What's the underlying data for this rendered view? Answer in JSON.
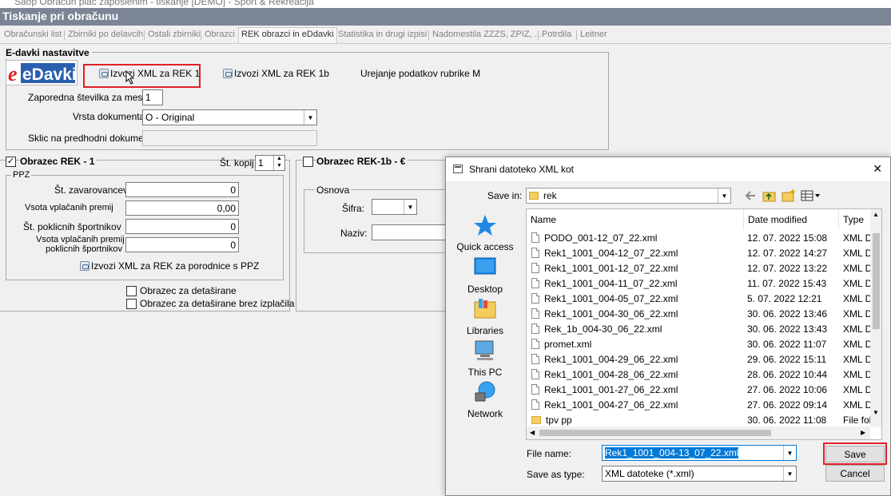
{
  "window": {
    "title": "Saop Obračun plač zaposlenim - tiskanje [DEMO] - Šport & Rekreacija",
    "header": "Tiskanje pri obračunu"
  },
  "tabs": [
    "Obračunski list",
    "Zbirniki po delavcih",
    "Ostali zbirniki",
    "Obrazci",
    "REK obrazci  in eDdavki",
    "Statistika in drugi izpisi",
    "Nadomestila ZZZS, ZPIZ, ...",
    "Potrdila",
    "Leitner"
  ],
  "edavki": {
    "group_title": "E-davki nastavitve",
    "logo_text": "eDavki",
    "btn_rek1": "Izvozi XML za REK 1",
    "btn_rek1b": "Izvozi XML za REK 1b",
    "btn_rubrika_m": "Urejanje podatkov rubrike M",
    "zaporedna_label": "Zaporedna številka za mesec",
    "zaporedna_value": "1",
    "vrsta_label": "Vrsta dokumenta",
    "vrsta_value": "O - Original",
    "sklic_label": "Sklic na predhodni dokument",
    "sklic_value": ""
  },
  "rek1": {
    "title": "Obrazec REK - 1",
    "checked": true,
    "kopij_label": "Št. kopij",
    "kopij_value": "1",
    "ppz_title": "PPZ",
    "zavarovancev_label": "Št. zavarovancev",
    "zavarovancev_value": "0",
    "vplacanih_label": "Vsota vplačanih premij",
    "vplacanih_value": "0,00",
    "sportnikov_label": "Št. poklicnih športnikov",
    "sportnikov_value": "0",
    "vsota_sport_label1": "Vsota vplačanih premij",
    "vsota_sport_label2": "poklicnih športnikov",
    "vsota_sport_value": "0",
    "btn_ppz": "Izvozi XML za REK za porodnice s PPZ",
    "chk_detasirane": "Obrazec za detaširane",
    "chk_detasirane_brez": "Obrazec za detaširane brez izplačila"
  },
  "rek1b": {
    "title": "Obrazec REK-1b - €",
    "checked": false,
    "osnova_title": "Osnova",
    "sifra_label": "Šifra:",
    "naziv_label": "Naziv:"
  },
  "dialog": {
    "title": "Shrani datoteko XML kot",
    "save_in_label": "Save in:",
    "save_in_value": "rek",
    "places": [
      "Quick access",
      "Desktop",
      "Libraries",
      "This PC",
      "Network"
    ],
    "columns": [
      "Name",
      "Date modified",
      "Type"
    ],
    "files": [
      {
        "name": "PODO_001-12_07_22.xml",
        "date": "12. 07. 2022 15:08",
        "type": "XML D",
        "folder": false
      },
      {
        "name": "Rek1_1001_004-12_07_22.xml",
        "date": "12. 07. 2022 14:27",
        "type": "XML D",
        "folder": false
      },
      {
        "name": "Rek1_1001_001-12_07_22.xml",
        "date": "12. 07. 2022 13:22",
        "type": "XML D",
        "folder": false
      },
      {
        "name": "Rek1_1001_004-11_07_22.xml",
        "date": "11. 07. 2022 15:43",
        "type": "XML D",
        "folder": false
      },
      {
        "name": "Rek1_1001_004-05_07_22.xml",
        "date": "5. 07. 2022 12:21",
        "type": "XML D",
        "folder": false
      },
      {
        "name": "Rek1_1001_004-30_06_22.xml",
        "date": "30. 06. 2022 13:46",
        "type": "XML D",
        "folder": false
      },
      {
        "name": "Rek_1b_004-30_06_22.xml",
        "date": "30. 06. 2022 13:43",
        "type": "XML D",
        "folder": false
      },
      {
        "name": "promet.xml",
        "date": "30. 06. 2022 11:07",
        "type": "XML D",
        "folder": false
      },
      {
        "name": "Rek1_1001_004-29_06_22.xml",
        "date": "29. 06. 2022 15:11",
        "type": "XML D",
        "folder": false
      },
      {
        "name": "Rek1_1001_004-28_06_22.xml",
        "date": "28. 06. 2022 10:44",
        "type": "XML D",
        "folder": false
      },
      {
        "name": "Rek1_1001_001-27_06_22.xml",
        "date": "27. 06. 2022 10:06",
        "type": "XML D",
        "folder": false
      },
      {
        "name": "Rek1_1001_004-27_06_22.xml",
        "date": "27. 06. 2022 09:14",
        "type": "XML D",
        "folder": false
      },
      {
        "name": "tpv pp",
        "date": "30. 06. 2022 11:08",
        "type": "File fol",
        "folder": true
      }
    ],
    "filename_label": "File name:",
    "filename_value": "Rek1_1001_004-13_07_22.xml",
    "savetype_label": "Save as type:",
    "savetype_value": "XML datoteke (*.xml)",
    "save_button": "Save",
    "cancel_button": "Cancel",
    "close_symbol": "✕"
  },
  "colors": {
    "header_bg": "#7b8595",
    "highlight": "#e0202a",
    "selection": "#0078d7"
  }
}
